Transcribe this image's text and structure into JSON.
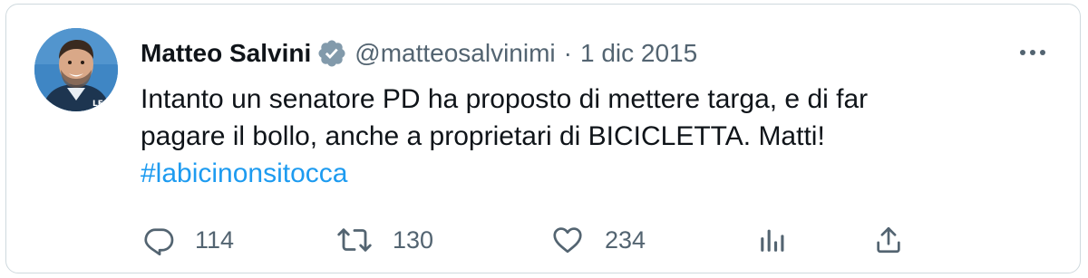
{
  "tweet": {
    "display_name": "Matteo Salvini",
    "handle": "@matteosalvinimi",
    "separator": "·",
    "date": "1 dic 2015",
    "text_line1": "Intanto un senatore PD ha proposto di mettere targa, e di far",
    "text_line2": "pagare il bollo, anche a proprietari di BICICLETTA. Matti!",
    "hashtag": "#labicinonsitocca",
    "verified": true
  },
  "actions": {
    "replies": "114",
    "retweets": "130",
    "likes": "234"
  },
  "icons": {
    "verified": "verified-badge-icon",
    "more": "more-icon",
    "reply": "reply-icon",
    "retweet": "retweet-icon",
    "like": "heart-icon",
    "views": "views-chart-icon",
    "share": "share-icon"
  },
  "colors": {
    "text": "#0f1419",
    "secondary": "#536471",
    "link": "#1d9bf0",
    "border": "#cfd9de",
    "verified_badge": "#829aab"
  }
}
